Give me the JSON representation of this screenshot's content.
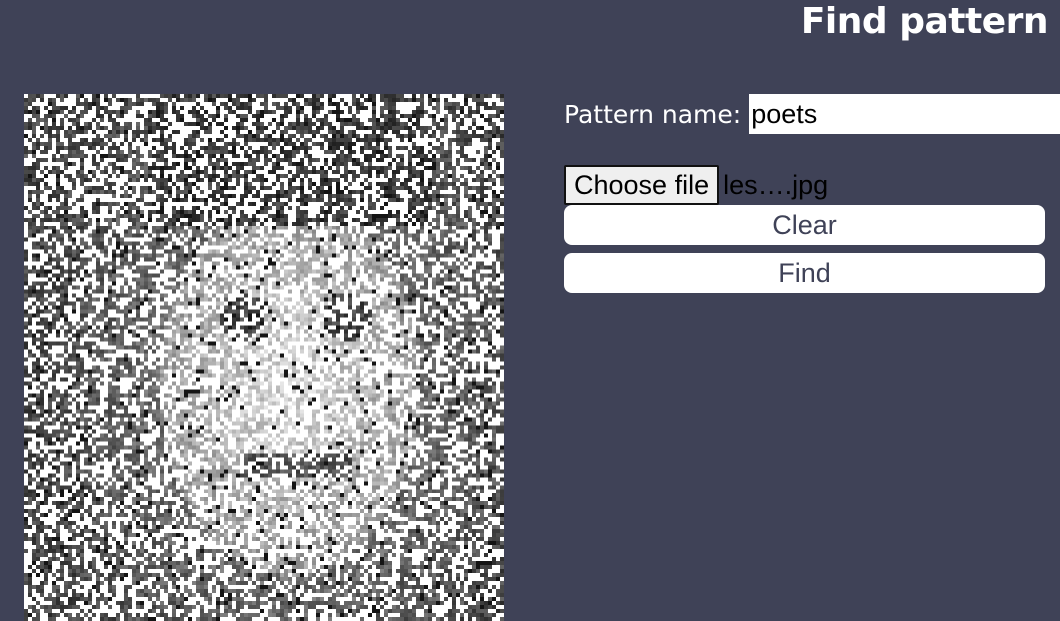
{
  "header": {
    "title": "Find pattern"
  },
  "image": {
    "description_icon": "noisy-portrait-image"
  },
  "form": {
    "pattern_name_label": "Pattern name:",
    "pattern_name_value": "poets",
    "file_button_label": "Choose file",
    "file_name": "les….jpg",
    "clear_label": "Clear",
    "find_label": "Find"
  },
  "colors": {
    "background": "#3f4257",
    "button_text": "#3f4257",
    "title_text": "#ffffff"
  }
}
